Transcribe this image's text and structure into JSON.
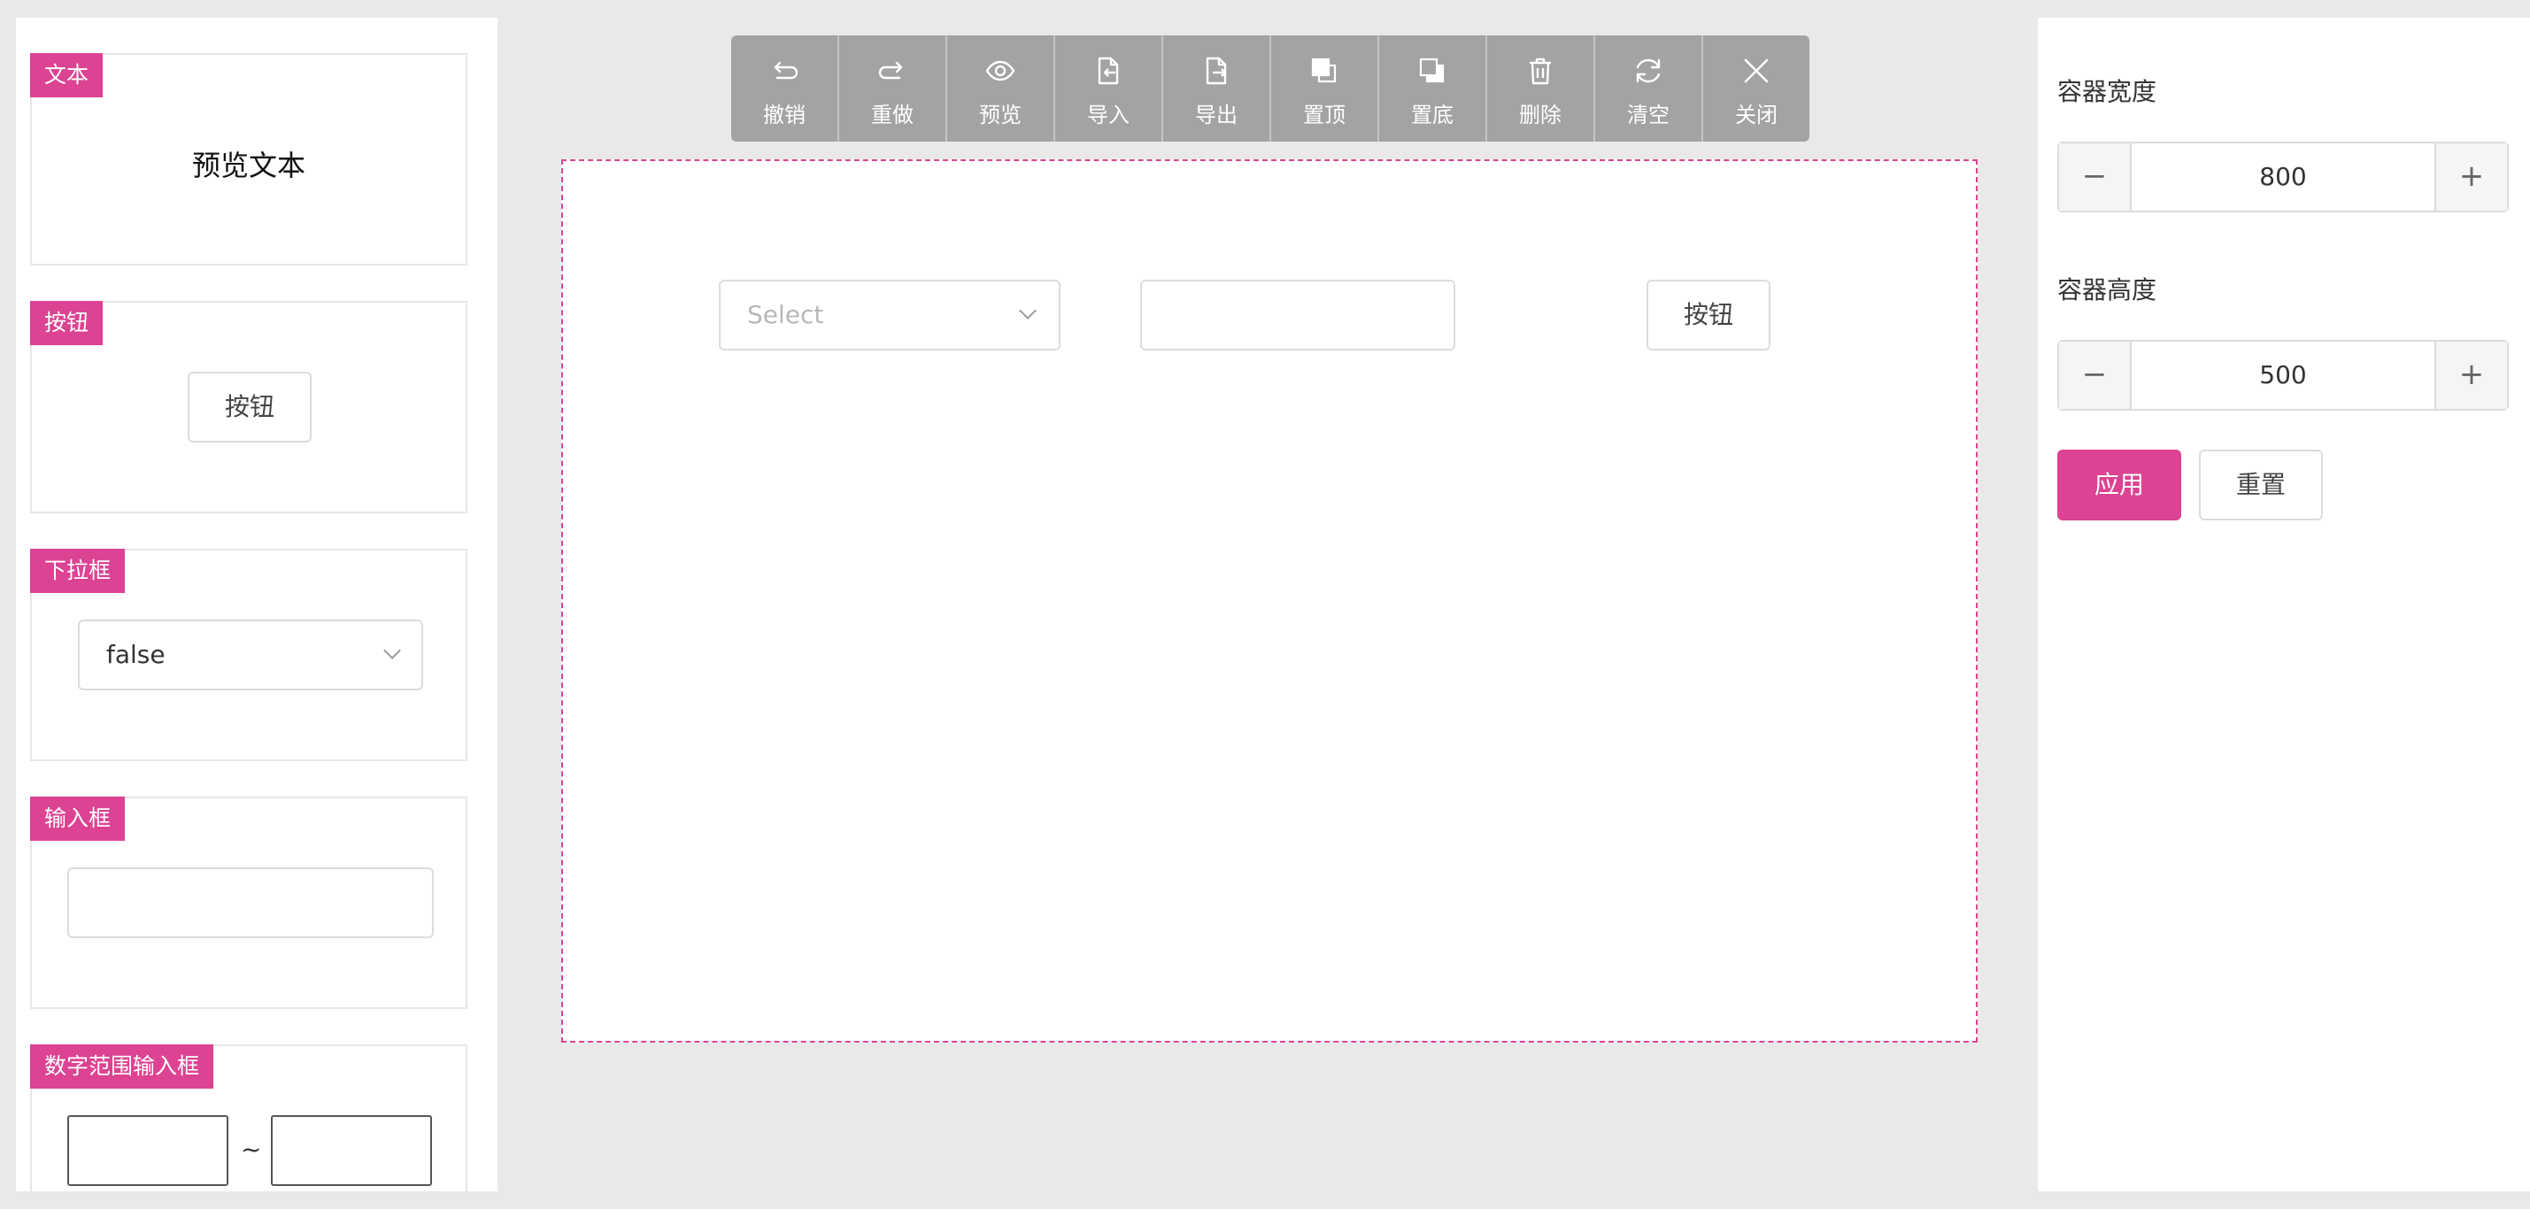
{
  "palette": {
    "text_card": {
      "tag": "文本",
      "preview": "预览文本"
    },
    "button_card": {
      "tag": "按钮",
      "button_label": "按钮"
    },
    "select_card": {
      "tag": "下拉框",
      "selected_value": "false"
    },
    "input_card": {
      "tag": "输入框",
      "value": ""
    },
    "range_card": {
      "tag": "数字范围输入框",
      "separator": "~"
    }
  },
  "toolbar": {
    "undo": "撤销",
    "redo": "重做",
    "preview": "预览",
    "import": "导入",
    "export": "导出",
    "bring_to_front": "置顶",
    "send_to_back": "置底",
    "delete": "删除",
    "clear": "清空",
    "close": "关闭"
  },
  "canvas": {
    "select_placeholder": "Select",
    "input_value": "",
    "button_label": "按钮"
  },
  "settings": {
    "width_label": "容器宽度",
    "width_value": "800",
    "height_label": "容器高度",
    "height_value": "500",
    "minus_symbol": "−",
    "plus_symbol": "+",
    "apply_label": "应用",
    "reset_label": "重置"
  },
  "colors": {
    "accent": "#dc4392",
    "toolbar_bg": "#a3a3a3"
  }
}
